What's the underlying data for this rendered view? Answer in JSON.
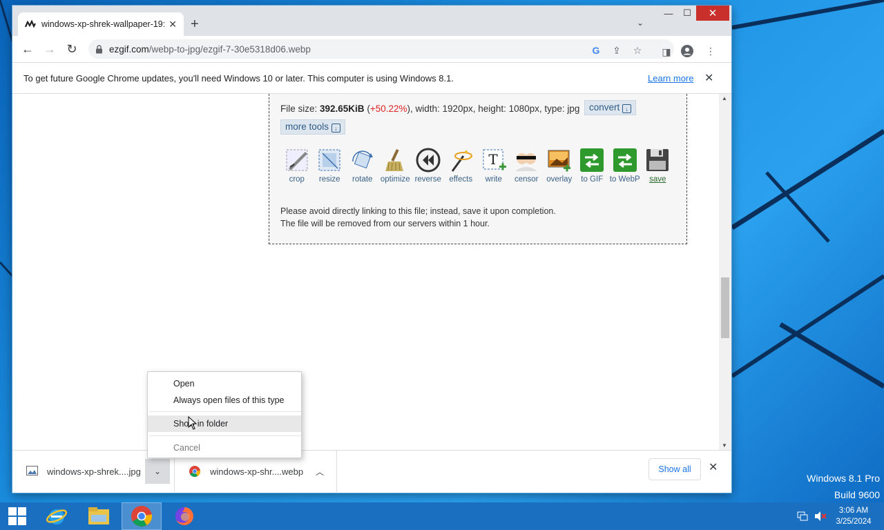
{
  "desktop": {
    "watermark_line1": "Windows 8.1 Pro",
    "watermark_line2": "Build 9600"
  },
  "browser": {
    "tab_title": "windows-xp-shrek-wallpaper-19:",
    "url_host": "ezgif.com",
    "url_path": "/webp-to-jpg/ezgif-7-30e5318d06.webp",
    "infobar_message": "To get future Google Chrome updates, you'll need Windows 10 or later. This computer is using Windows 8.1.",
    "infobar_link": "Learn more"
  },
  "page": {
    "file_size_label": "File size: ",
    "file_size": "392.65KiB",
    "size_change": "+50.22%",
    "file_details": "), width: 1920px, height: 1080px, type: jpg",
    "convert_label": "convert",
    "more_tools_label": "more tools",
    "tools": [
      {
        "label": "crop",
        "icon": "crop-icon"
      },
      {
        "label": "resize",
        "icon": "resize-icon"
      },
      {
        "label": "rotate",
        "icon": "rotate-icon"
      },
      {
        "label": "optimize",
        "icon": "optimize-icon"
      },
      {
        "label": "reverse",
        "icon": "reverse-icon"
      },
      {
        "label": "effects",
        "icon": "effects-icon"
      },
      {
        "label": "write",
        "icon": "write-icon"
      },
      {
        "label": "censor",
        "icon": "censor-icon"
      },
      {
        "label": "overlay",
        "icon": "overlay-icon"
      },
      {
        "label": "to GIF",
        "icon": "to-gif-icon"
      },
      {
        "label": "to WebP",
        "icon": "to-webp-icon"
      },
      {
        "label": "save",
        "icon": "save-icon"
      }
    ],
    "note_line1": "Please avoid directly linking to this file; instead, save it upon completion.",
    "note_line2": "The file will be removed from our servers within 1 hour."
  },
  "context_menu": {
    "open": "Open",
    "always_open": "Always open files of this type",
    "show_in_folder": "Show in folder",
    "cancel": "Cancel"
  },
  "downloads": {
    "item1": "windows-xp-shrek....jpg",
    "item2": "windows-xp-shr....webp",
    "show_all": "Show all"
  },
  "taskbar": {
    "time": "3:06 AM",
    "date": "3/25/2024"
  },
  "colors": {
    "size_change": "#dd2222",
    "link": "#1a73e8",
    "close_button": "#c9302c",
    "taskbar": "#1a6fc0"
  }
}
